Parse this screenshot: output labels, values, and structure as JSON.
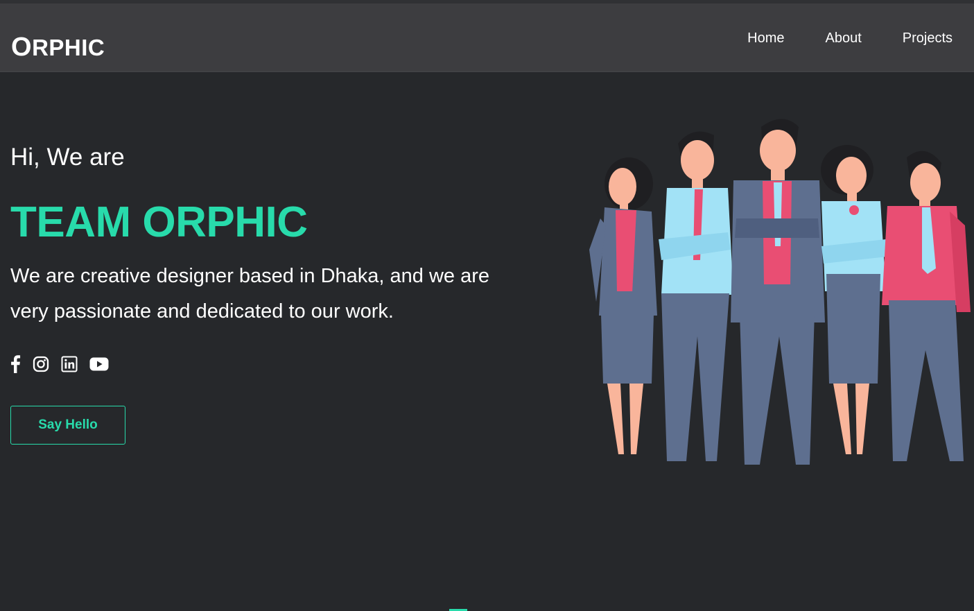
{
  "header": {
    "logo_first": "O",
    "logo_rest": "RPHIC",
    "nav": [
      {
        "label": "Home"
      },
      {
        "label": "About"
      },
      {
        "label": "Projects"
      }
    ]
  },
  "hero": {
    "greeting": "Hi, We are",
    "title": "TEAM ORPHIC",
    "description": "We are creative designer based in Dhaka, and we are very passionate and dedicated to our work.",
    "cta_label": "Say Hello"
  },
  "socials": [
    {
      "icon": "facebook-icon"
    },
    {
      "icon": "instagram-icon"
    },
    {
      "icon": "linkedin-icon"
    },
    {
      "icon": "youtube-icon"
    }
  ],
  "colors": {
    "background": "#26282b",
    "navbar": "#3d3d40",
    "accent": "#28dbab",
    "text": "#ffffff"
  }
}
